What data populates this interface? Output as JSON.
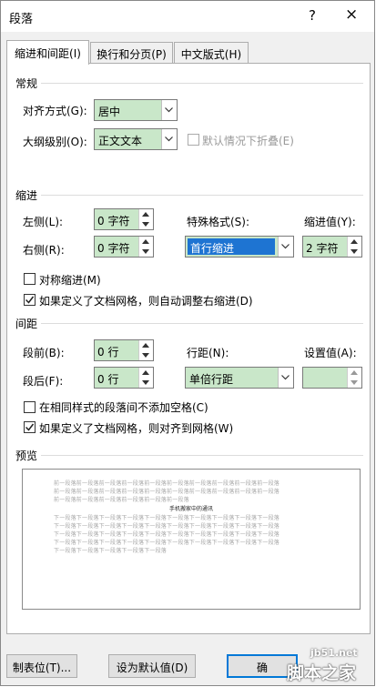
{
  "window": {
    "title": "段落",
    "help": "?",
    "close": "×"
  },
  "tabs": [
    "缩进和间距(I)",
    "换行和分页(P)",
    "中文版式(H)"
  ],
  "general": {
    "section": "常规",
    "alignment_label": "对齐方式(G):",
    "alignment_value": "居中",
    "outline_label": "大纲级别(O):",
    "outline_value": "正文文本",
    "collapse_label": "默认情况下折叠(E)"
  },
  "indent": {
    "section": "缩进",
    "left_label": "左侧(L):",
    "left_value": "0 字符",
    "right_label": "右侧(R):",
    "right_value": "0 字符",
    "special_label": "特殊格式(S):",
    "special_value": "首行缩进",
    "by_label": "缩进值(Y):",
    "by_value": "2 字符",
    "mirror_label": "对称缩进(M)",
    "auto_adjust_label": "如果定义了文档网格，则自动调整右缩进(D)"
  },
  "spacing": {
    "section": "间距",
    "before_label": "段前(B):",
    "before_value": "0 行",
    "after_label": "段后(F):",
    "after_value": "0 行",
    "line_label": "行距(N):",
    "line_value": "单倍行距",
    "at_label": "设置值(A):",
    "at_value": "",
    "no_space_label": "在相同样式的段落间不添加空格(C)",
    "snap_grid_label": "如果定义了文档网格，则对齐到网格(W)"
  },
  "preview": {
    "section": "预览",
    "prev_lines": [
      "前一段落前一段落前一段落前一段落前一段落前一段落前一段落前一段落前一段落前一段落",
      "前一段落前一段落前一段落前一段落前一段落前一段落前一段落前一段落前一段落前一段落",
      "前一段落前一段落前一段落前一段落前一段落前一段落"
    ],
    "current_line": "手机搬家中的通讯",
    "next_lines": [
      "下一段落下一段落下一段落下一段落下一段落下一段落下一段落下一段落下一段落下一段落",
      "下一段落下一段落下一段落下一段落下一段落下一段落下一段落下一段落下一段落下一段落",
      "下一段落下一段落下一段落下一段落下一段落下一段落下一段落下一段落下一段落下一段落",
      "下一段落下一段落下一段落下一段落下一段落下一段落下一段落下一段落下一段落下一段落",
      "下一段落下一段落下一段落下一段落下一段落"
    ]
  },
  "buttons": {
    "tabs": "制表位(T)...",
    "default": "设为默认值(D)",
    "ok": "确"
  },
  "watermark": {
    "site": "jb51.net",
    "brand": "脚本之家"
  },
  "colors": {
    "field_bg": "#c9e7c9",
    "selection": "#1e74d2"
  }
}
